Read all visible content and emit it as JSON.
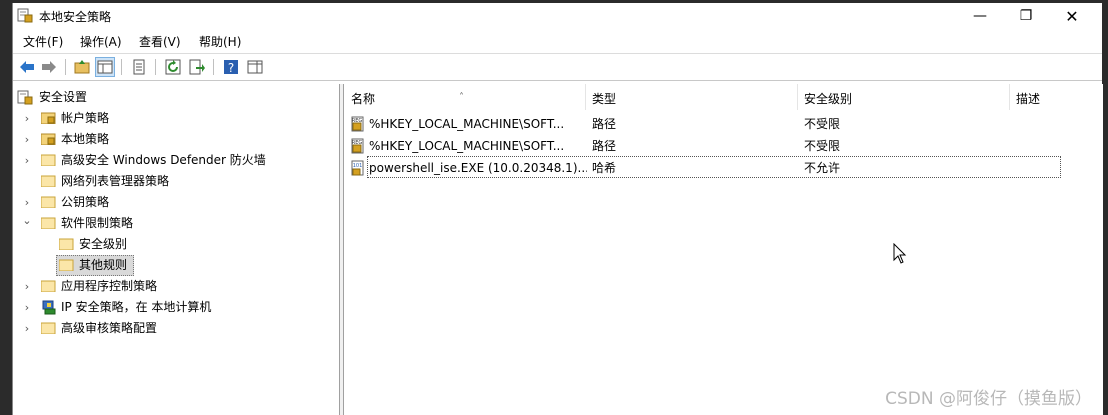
{
  "window": {
    "title": "本地安全策略",
    "controls": {
      "minimize": "—",
      "maximize": "❐",
      "close": "✕"
    }
  },
  "menu": [
    "文件(F)",
    "操作(A)",
    "查看(V)",
    "帮助(H)"
  ],
  "toolbar_icons": [
    "back-arrow-icon",
    "forward-arrow-icon",
    "up-folder-icon",
    "show-tree-icon",
    "properties-icon",
    "refresh-icon",
    "export-list-icon",
    "help-icon",
    "show-hide-action-pane-icon"
  ],
  "tree": {
    "root": "安全设置",
    "items": [
      {
        "label": "帐户策略",
        "expander": "›"
      },
      {
        "label": "本地策略",
        "expander": "›"
      },
      {
        "label": "高级安全 Windows Defender 防火墙",
        "expander": "›"
      },
      {
        "label": "网络列表管理器策略",
        "expander": ""
      },
      {
        "label": "公钥策略",
        "expander": "›"
      },
      {
        "label": "软件限制策略",
        "expander": "⌄"
      },
      {
        "label": "安全级别",
        "expander": ""
      },
      {
        "label": "其他规则",
        "expander": ""
      },
      {
        "label": "应用程序控制策略",
        "expander": "›"
      },
      {
        "label": "IP 安全策略，在 本地计算机",
        "expander": "›"
      },
      {
        "label": "高级审核策略配置",
        "expander": "›"
      }
    ]
  },
  "list": {
    "columns": [
      "名称",
      "类型",
      "安全级别",
      "描述"
    ],
    "sort_indicator": "˄",
    "rows": [
      {
        "name": "%HKEY_LOCAL_MACHINE\\SOFT...",
        "type": "路径",
        "level": "不受限",
        "desc": ""
      },
      {
        "name": "%HKEY_LOCAL_MACHINE\\SOFT...",
        "type": "路径",
        "level": "不受限",
        "desc": ""
      },
      {
        "name": "powershell_ise.EXE (10.0.20348.1)...",
        "type": "哈希",
        "level": "不允许",
        "desc": ""
      }
    ]
  },
  "watermark": "CSDN @阿俊仔（摸鱼版）"
}
